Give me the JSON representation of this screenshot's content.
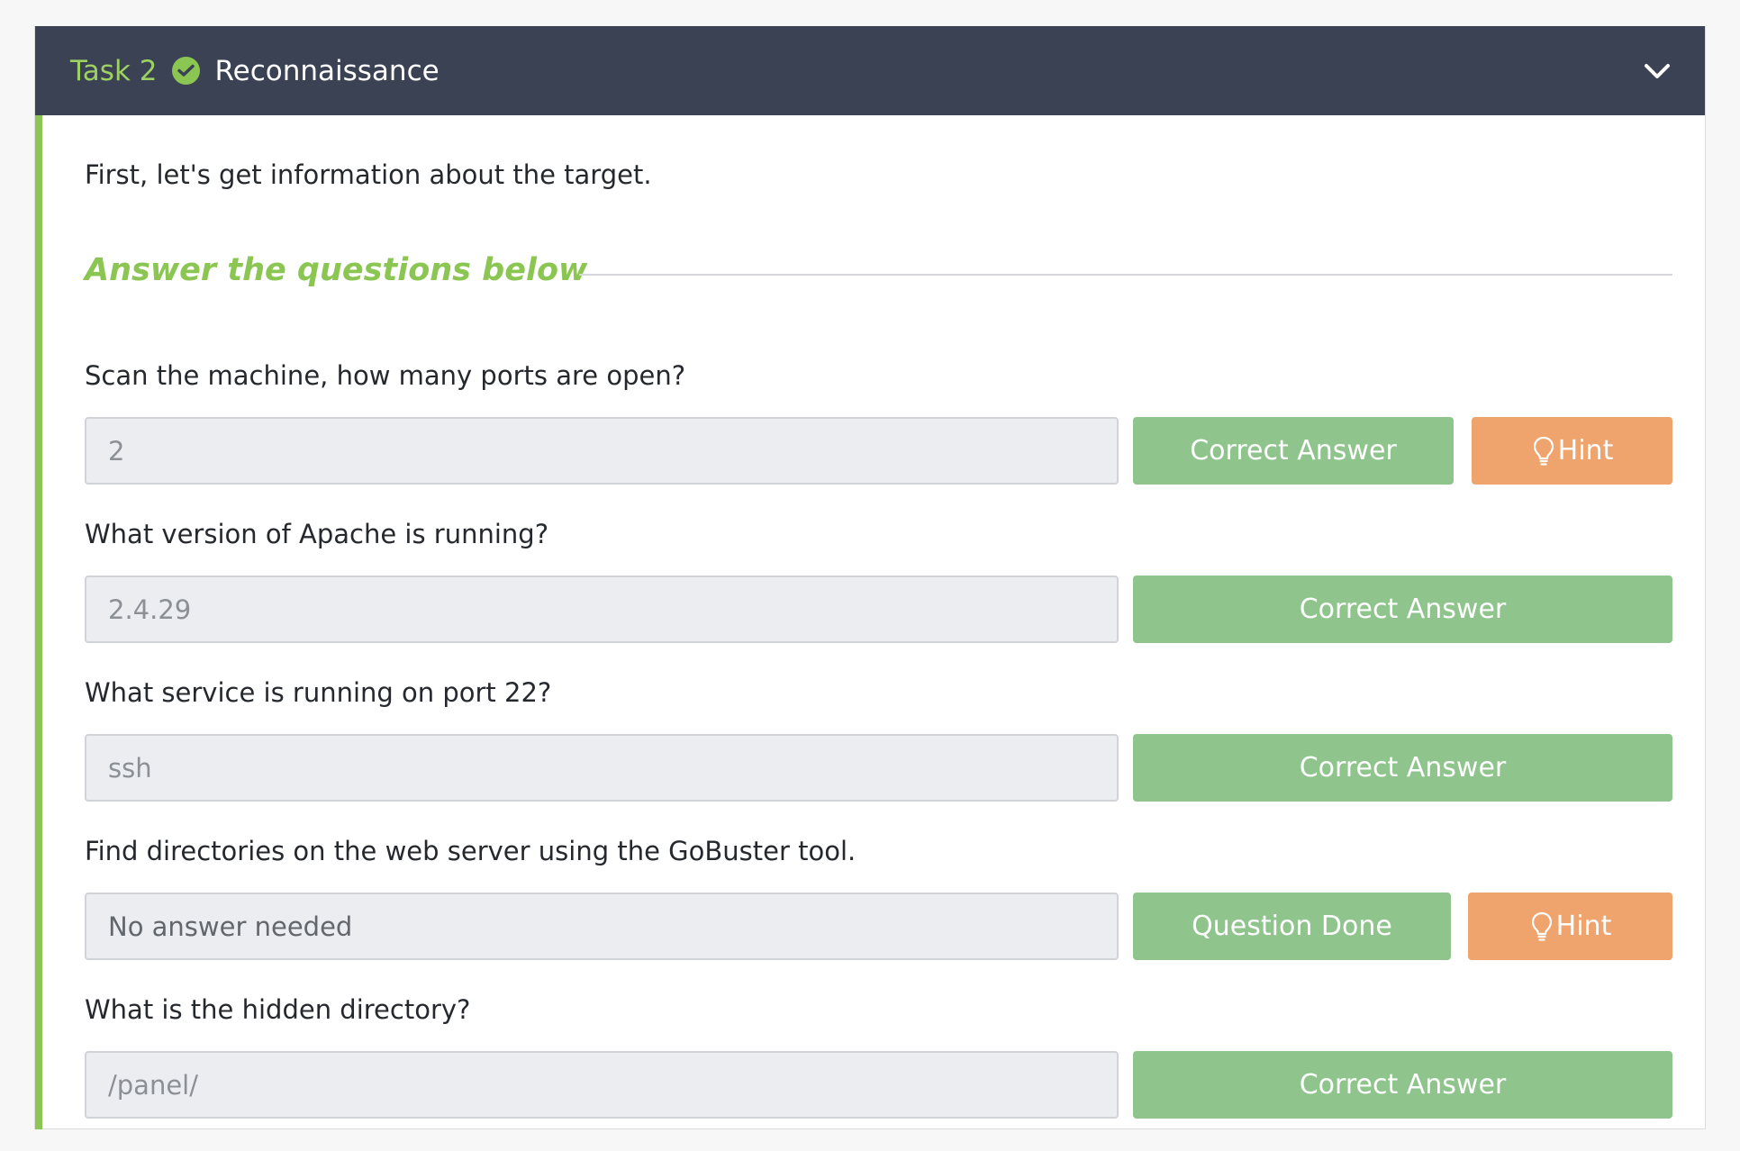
{
  "task": {
    "number_label": "Task 2",
    "title": "Reconnaissance",
    "intro": "First, let's get information about the target.",
    "section_title": "Answer the questions below"
  },
  "questions": [
    {
      "label": "Scan the machine, how many ports are open?",
      "answer": "2",
      "button": "Correct Answer",
      "hint": "Hint"
    },
    {
      "label": "What version of Apache is running?",
      "answer": "2.4.29",
      "button": "Correct Answer"
    },
    {
      "label": "What service is running on port 22?",
      "answer": "ssh",
      "button": "Correct Answer"
    },
    {
      "label": "Find directories on the web server using the GoBuster tool.",
      "answer": "No answer needed",
      "button": "Question Done",
      "hint": "Hint"
    },
    {
      "label": "What is the hidden directory?",
      "answer": "/panel/",
      "button": "Correct Answer"
    }
  ],
  "colors": {
    "header_bg": "#3b4253",
    "accent_green": "#8cc652",
    "button_green": "#8fc48d",
    "button_orange": "#efa36d"
  },
  "icons": [
    "check-circle-icon",
    "chevron-down-icon",
    "lightbulb-icon"
  ]
}
